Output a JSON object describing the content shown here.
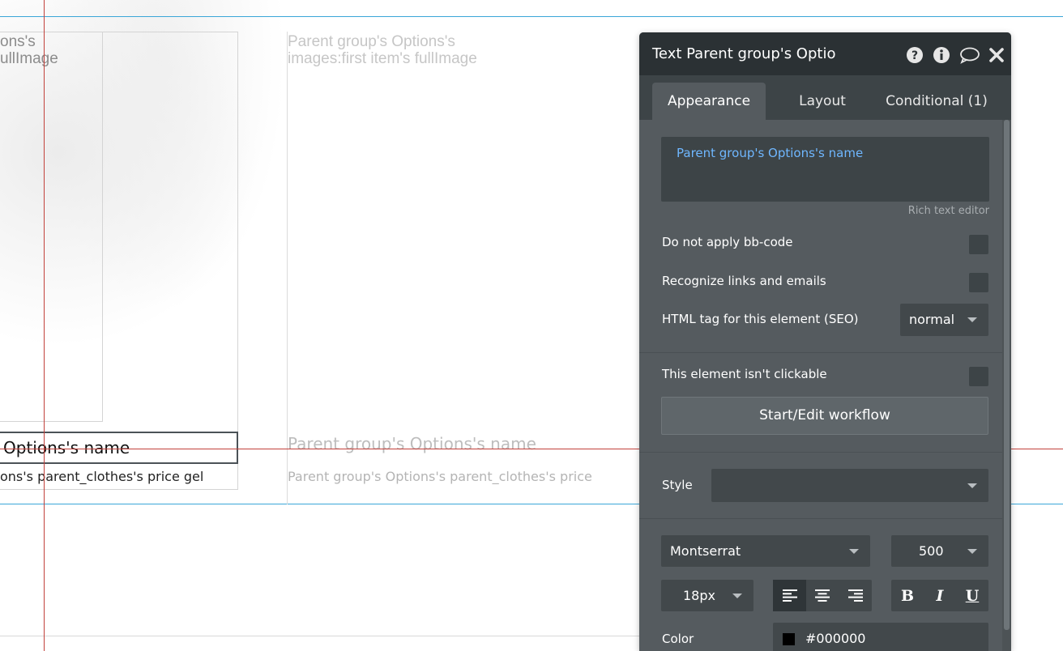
{
  "canvas": {
    "left_image_text_line1": "ons's",
    "left_image_text_line2": "ullImage",
    "right_image_text_line1": "Parent group's Options's",
    "right_image_text_line2": "images:first item's fullImage",
    "selected_name_text": "Options's name",
    "name_text": "Parent group's Options's name",
    "selected_price_text": "ons's parent_clothes's price gel",
    "price_text": "Parent group's Options's parent_clothes's price"
  },
  "panel": {
    "title": "Text Parent group's Optio",
    "header_icons": [
      "help-icon",
      "info-icon",
      "comment-icon",
      "close-icon"
    ],
    "tabs": [
      {
        "label": "Appearance",
        "active": true
      },
      {
        "label": "Layout",
        "active": false
      },
      {
        "label": "Conditional (1)",
        "active": false
      }
    ],
    "rich_text": {
      "value": "Parent group's Options's name",
      "caption": "Rich text editor"
    },
    "options": {
      "bbcode_label": "Do not apply bb-code",
      "bbcode_checked": false,
      "links_label": "Recognize links and emails",
      "links_checked": false,
      "html_tag_label": "HTML tag for this element (SEO)",
      "html_tag_value": "normal",
      "clickable_label": "This element isn't clickable",
      "clickable_checked": false,
      "workflow_button": "Start/Edit workflow"
    },
    "style": {
      "label": "Style",
      "value": ""
    },
    "font": {
      "family": "Montserrat",
      "weight": "500",
      "size": "18px",
      "alignment": [
        "left-align-icon",
        "center-align-icon",
        "right-align-icon"
      ],
      "active_alignment": "left",
      "bold_label": "B",
      "italic_label": "I",
      "underline_label": "U"
    },
    "color": {
      "label": "Color",
      "value": "#000000"
    }
  },
  "colors": {
    "guide_blue": "#3aa6d8",
    "guide_red": "#c2413b",
    "panel_bg": "#555b5f",
    "panel_header": "#2b3134",
    "link_blue": "#6fb7ff"
  }
}
